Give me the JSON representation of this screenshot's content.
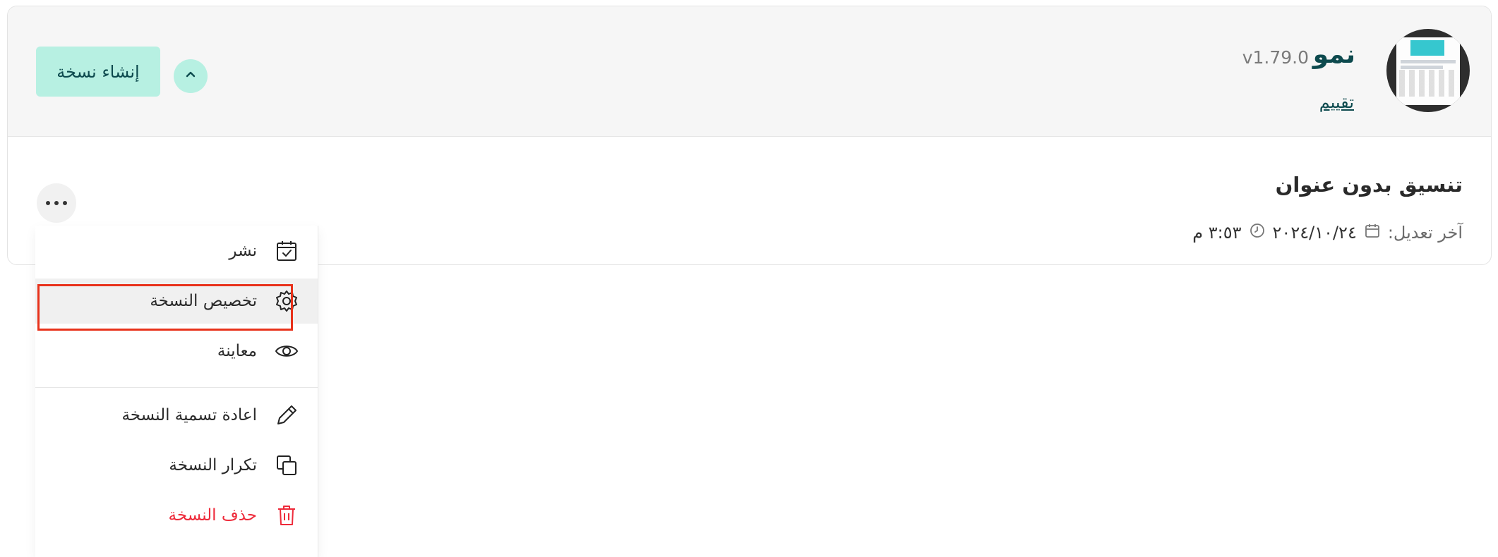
{
  "theme": {
    "name": "نمو",
    "version": "v1.79.0",
    "rate_label": "تقييم",
    "create_copy_label": "إنشاء نسخة"
  },
  "format": {
    "title": "تنسيق بدون عنوان",
    "last_modified_label": "آخر تعديل:",
    "date": "٢٠٢٤/١٠/٢٤",
    "time": "٣:٥٣ م"
  },
  "menu": {
    "items": [
      {
        "label": "نشر",
        "icon": "calendar-check-icon"
      },
      {
        "label": "تخصيص النسخة",
        "icon": "gear-icon"
      },
      {
        "label": "معاينة",
        "icon": "eye-icon"
      },
      {
        "label": "اعادة تسمية النسخة",
        "icon": "pencil-icon"
      },
      {
        "label": "تكرار النسخة",
        "icon": "copy-icon"
      },
      {
        "label": "حذف النسخة",
        "icon": "trash-icon"
      }
    ]
  },
  "colors": {
    "accent": "#b7f0e2",
    "brand_text": "#0d4a4e",
    "danger": "#ee2a3a",
    "highlight": "#e8321b"
  }
}
